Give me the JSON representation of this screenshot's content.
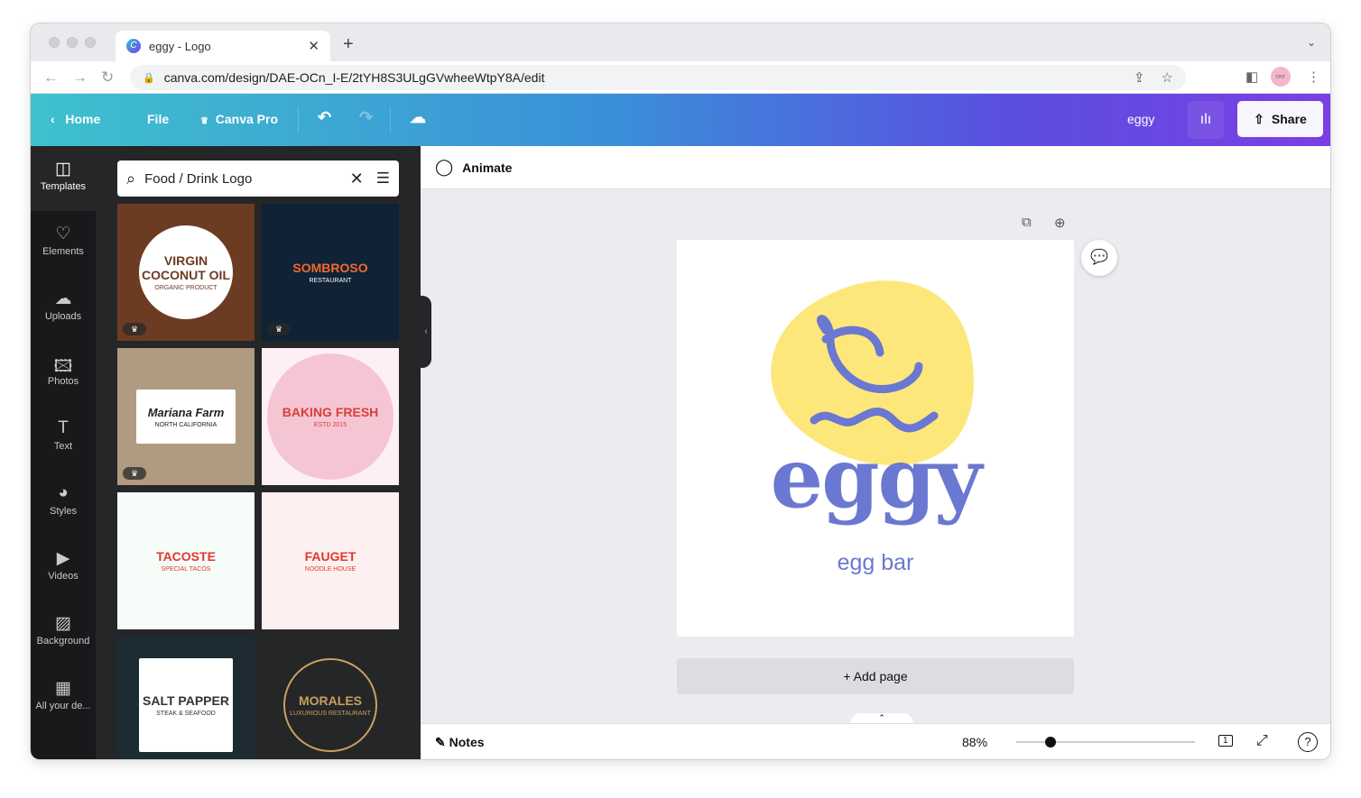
{
  "browser": {
    "tab_title": "eggy - Logo",
    "url": "canva.com/design/DAE-OCn_I-E/2tYH8S3ULgGVwheeWtpY8A/edit"
  },
  "header": {
    "home": "Home",
    "file": "File",
    "canva_pro": "Canva Pro",
    "design_name": "eggy",
    "share": "Share"
  },
  "sidebar": {
    "items": [
      {
        "label": "Templates",
        "icon": "templates-icon"
      },
      {
        "label": "Elements",
        "icon": "elements-icon"
      },
      {
        "label": "Uploads",
        "icon": "upload-icon"
      },
      {
        "label": "Photos",
        "icon": "photos-icon"
      },
      {
        "label": "Text",
        "icon": "text-icon"
      },
      {
        "label": "Styles",
        "icon": "styles-icon"
      },
      {
        "label": "Videos",
        "icon": "videos-icon"
      },
      {
        "label": "Background",
        "icon": "background-icon"
      },
      {
        "label": "All your de...",
        "icon": "all-designs-icon"
      }
    ]
  },
  "panel": {
    "search_value": "Food / Drink Logo",
    "templates": [
      {
        "title": "VIRGIN COCONUT OIL",
        "sub": "ORGANIC PRODUCT",
        "bg": "#6b3c22",
        "fg": "#6b3c22",
        "pro": true
      },
      {
        "title": "SOMBROSO",
        "sub": "RESTAURANT",
        "bg": "#0f2236",
        "fg": "#f26a2a",
        "pro": true
      },
      {
        "title": "Mariana Farm",
        "sub": "NORTH CALIFORNIA",
        "bg": "#b09a80",
        "fg": "#222",
        "pro": true
      },
      {
        "title": "BAKING FRESH",
        "sub": "ESTD 2015",
        "bg": "#fdf0f4",
        "fg": "#d6403a",
        "pro": false
      },
      {
        "title": "TACOSTE",
        "sub": "SPECIAL TACOS",
        "bg": "#f6fcf8",
        "fg": "#e2372a",
        "pro": false
      },
      {
        "title": "FAUGET",
        "sub": "NOODLE HOUSE",
        "bg": "#fdf0f0",
        "fg": "#e2372a",
        "pro": false
      },
      {
        "title": "SALT PAPPER",
        "sub": "STEAK & SEAFOOD",
        "bg": "#1d2b33",
        "fg": "#333",
        "pro": false
      },
      {
        "title": "MORALES",
        "sub": "LUXURIOUS RESTAURANT",
        "bg": "#252627",
        "fg": "#c8a060",
        "pro": false
      }
    ]
  },
  "editor": {
    "animate": "Animate",
    "add_page": "+ Add page",
    "notes": "Notes",
    "zoom": "88%",
    "zoom_value": 88,
    "page_number": "1"
  },
  "design": {
    "wordmark": "eggy",
    "tagline": "egg bar",
    "colors": {
      "blob": "#fee77a",
      "ink": "#6a78d1"
    }
  }
}
